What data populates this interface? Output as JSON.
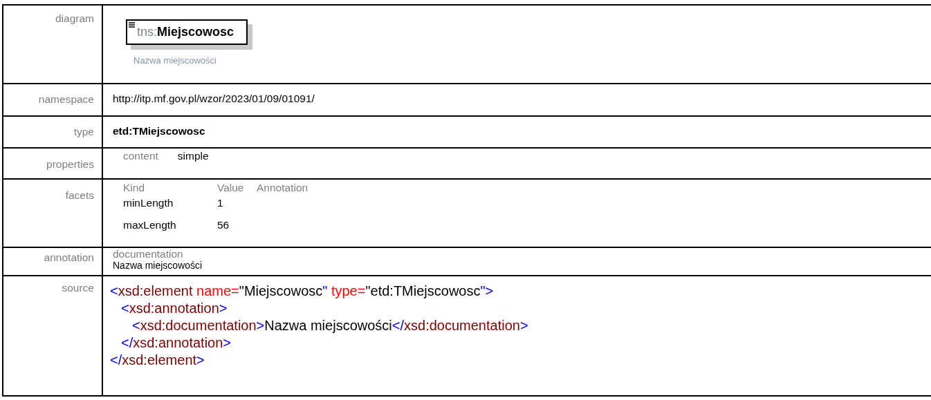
{
  "rows": [
    {
      "kind": "diagram",
      "label": "diagram",
      "element": {
        "prefix": "tns:",
        "name": "Miejscowosc"
      },
      "caption": "Nazwa miejscowości"
    },
    {
      "kind": "plain",
      "label": "namespace",
      "value": "http://itp.mf.gov.pl/wzor/2023/01/09/01091/"
    },
    {
      "kind": "bold",
      "label": "type",
      "value": "etd:TMiejscowosc"
    },
    {
      "kind": "properties",
      "label": "properties",
      "items": [
        {
          "key": "content",
          "value": "simple"
        }
      ]
    },
    {
      "kind": "facets",
      "label": "facets",
      "columns": [
        "Kind",
        "Value",
        "Annotation"
      ],
      "facets": [
        {
          "kind": "minLength",
          "value": "1"
        },
        {
          "kind": "maxLength",
          "value": "56"
        }
      ]
    },
    {
      "kind": "annotation",
      "label": "annotation",
      "heading": "documentation",
      "text": "Nazwa miejscowości"
    },
    {
      "kind": "source",
      "label": "source",
      "nodes": [
        {
          "open": [
            {
              "kind": "bracket",
              "text": "<"
            },
            {
              "kind": "tag",
              "text": "xsd:element"
            },
            {
              "kind": "attr",
              "text": " name="
            },
            {
              "kind": "text",
              "text": "\"Miejscowosc"
            },
            {
              "kind": "bracket",
              "text": "\""
            },
            {
              "kind": "attr",
              "text": " type="
            },
            {
              "kind": "text",
              "text": "\"etd:TMiejscowosc"
            },
            {
              "kind": "bracket",
              "text": "\">"
            }
          ],
          "children": [
            {
              "open": [
                {
                  "kind": "bracket",
                  "text": "<"
                },
                {
                  "kind": "tag",
                  "text": "xsd:annotation"
                },
                {
                  "kind": "bracket",
                  "text": ">"
                }
              ],
              "children": [
                {
                  "open": [
                    {
                      "kind": "bracket",
                      "text": "<"
                    },
                    {
                      "kind": "tag",
                      "text": "xsd:documentation"
                    },
                    {
                      "kind": "bracket",
                      "text": ">"
                    },
                    {
                      "kind": "text",
                      "text": "Nazwa miejscowości"
                    },
                    {
                      "kind": "bracket",
                      "text": "</"
                    },
                    {
                      "kind": "tag",
                      "text": "xsd:documentation"
                    },
                    {
                      "kind": "bracket",
                      "text": ">"
                    }
                  ]
                }
              ],
              "close": [
                {
                  "kind": "bracket",
                  "text": "</"
                },
                {
                  "kind": "tag",
                  "text": "xsd:annotation"
                },
                {
                  "kind": "bracket",
                  "text": ">"
                }
              ]
            }
          ],
          "close": [
            {
              "kind": "bracket",
              "text": "</"
            },
            {
              "kind": "tag",
              "text": "xsd:element"
            },
            {
              "kind": "bracket",
              "text": ">"
            }
          ]
        }
      ]
    }
  ]
}
